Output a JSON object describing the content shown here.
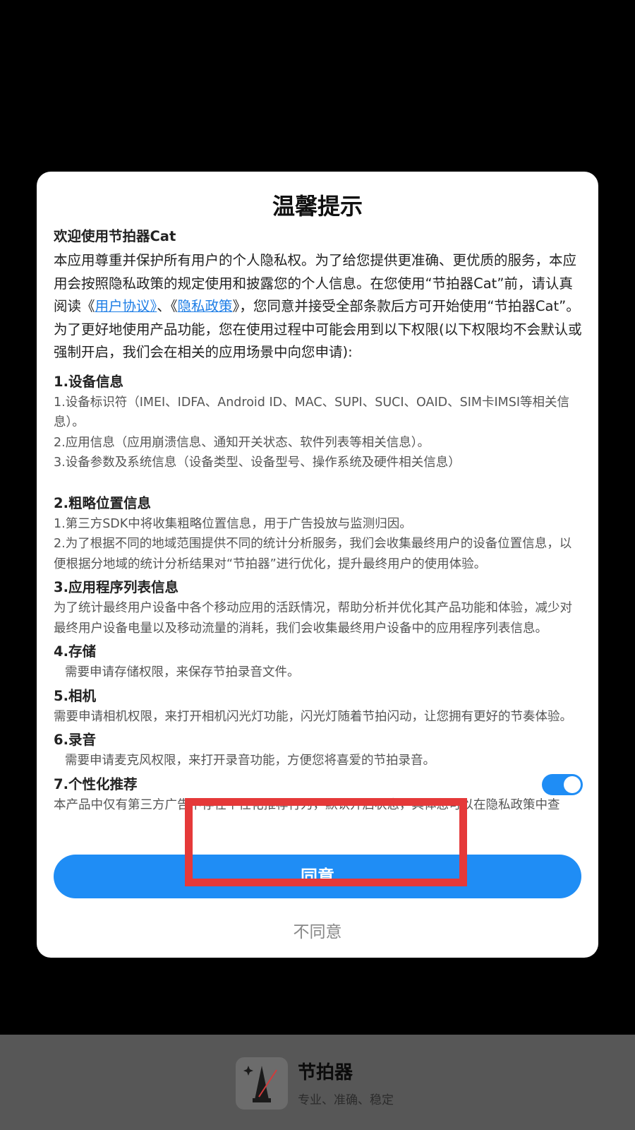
{
  "dialog": {
    "title": "温馨提示",
    "intro_heading": "欢迎使用节拍器Cat",
    "intro_p1_a": "本应用尊重并保护所有用户的个人隐私权。为了给您提供更准确、更优质的服务，本应用会按照隐私政策的规定使用和披露您的个人信息。在您使用“节拍器Cat”前，请认真阅读《",
    "link_user_agreement": "用户协议》",
    "intro_p1_b": "、《",
    "link_privacy_policy": "隐私政策",
    "intro_p1_c": "》，您同意并接受全部条款后方可开始使用“节拍器Cat”。",
    "intro_p2": "为了更好地使用产品功能，您在使用过程中可能会用到以下权限(以下权限均不会默认或强制开启，我们会在相关的应用场景中向您申请):",
    "sections": [
      {
        "title": "1.设备信息",
        "lines": [
          "1.设备标识符（IMEI、IDFA、Android ID、MAC、SUPI、SUCI、OAID、SIM卡IMSI等相关信息）。",
          " 2.应用信息（应用崩溃信息、通知开关状态、软件列表等相关信息）。",
          "3.设备参数及系统信息（设备类型、设备型号、操作系统及硬件相关信息）"
        ]
      },
      {
        "title": "2.粗略位置信息",
        "lines": [
          "1.第三方SDK中将收集粗略位置信息，用于广告投放与监测归因。",
          "2.为了根据不同的地域范围提供不同的统计分析服务，我们会收集最终用户的设备位置信息，以便根据分地域的统计分析结果对“节拍器”进行优化，提升最终用户的使用体验。"
        ]
      },
      {
        "title": "3.应用程序列表信息",
        "lines": [
          "为了统计最终用户设备中各个移动应用的活跃情况，帮助分析并优化其产品功能和体验，减少对最终用户设备电量以及移动流量的消耗，我们会收集最终用户设备中的应用程序列表信息。"
        ]
      },
      {
        "title": "4.存储",
        "lines": [
          "需要申请存储权限，来保存节拍录音文件。"
        ]
      },
      {
        "title": "5.相机",
        "lines": [
          "需要申请相机权限，来打开相机闪光灯功能，闪光灯随着节拍闪动，让您拥有更好的节奏体验。"
        ]
      },
      {
        "title": "6.录音",
        "lines": [
          "需要申请麦克风权限，来打开录音功能，方便您将喜爱的节拍录音。"
        ]
      },
      {
        "title": "7.个性化推荐",
        "lines": [
          "本产品中仅有第三方广告中存在个性化推荐行为，默认开启状态，具体您可以在隐私政策中查"
        ],
        "toggle_on": true
      }
    ],
    "agree_label": "同意",
    "disagree_label": "不同意"
  },
  "bottom_bar": {
    "app_name": "节拍器",
    "app_slogan": "专业、准确、稳定",
    "app_icon": "metronome-icon"
  },
  "colors": {
    "accent": "#1f8df5",
    "link": "#1e7ee6",
    "highlight_border": "#e53939",
    "backdrop": "#000000",
    "bottom_bar": "#575757"
  }
}
